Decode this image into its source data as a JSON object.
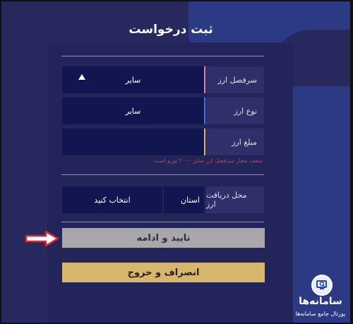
{
  "form": {
    "title": "ثبت درخواست",
    "fields": {
      "currency_heading": {
        "label": "سرفصل ارز",
        "value": "سایر"
      },
      "currency_type": {
        "label": "نوع ارز",
        "value": "سایر"
      },
      "amount": {
        "label": "مبلغ ارز",
        "value": ""
      },
      "receive_place": {
        "label": "محل دریافت ارز",
        "province": "استان",
        "choose": "انتخاب کنید"
      }
    },
    "warning": "سقف مجاز سرفصل ارز سایر ۲۰۰۰ یورو است"
  },
  "buttons": {
    "confirm": "تایید و ادامه",
    "cancel": "انصراف و خروج"
  },
  "brand": {
    "name": "سامانه‌ها",
    "subtitle": "پورتال جامع سامانه‌ها"
  },
  "icons": [
    "triangle-up-icon",
    "red-arrow-icon",
    "magnifier-icon"
  ],
  "colors": {
    "background": "#26285e",
    "input": "#121650",
    "label_box": "#2f2f6a",
    "accent_pink": "#d48a9a",
    "accent_blue": "#4f6cd8",
    "accent_gold": "#d8b66d",
    "warning": "#d1404a"
  }
}
